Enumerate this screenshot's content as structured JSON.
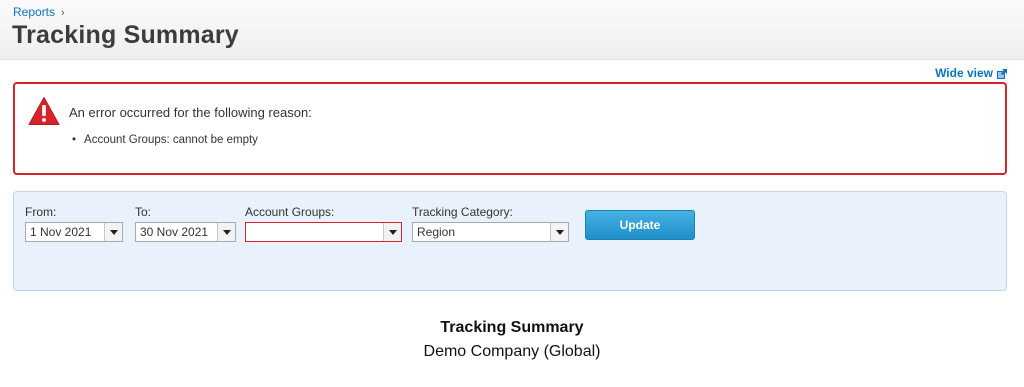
{
  "header": {
    "breadcrumb": {
      "link": "Reports",
      "separator": "›"
    },
    "title": "Tracking Summary"
  },
  "wide_view": {
    "label": "Wide view",
    "icon": "expand-icon"
  },
  "error": {
    "icon": "warning-icon",
    "title": "An error occurred for the following reason:",
    "items": [
      "Account Groups: cannot be empty"
    ],
    "border_color": "#d9232a"
  },
  "filters": {
    "from": {
      "label": "From:",
      "value": "1 Nov 2021"
    },
    "to": {
      "label": "To:",
      "value": "30 Nov 2021"
    },
    "account_groups": {
      "label": "Account Groups:",
      "value": ""
    },
    "tracking_category": {
      "label": "Tracking Category:",
      "value": "Region"
    },
    "update_label": "Update"
  },
  "report": {
    "title": "Tracking Summary",
    "subtitle": "Demo Company (Global)"
  },
  "colors": {
    "link": "#0b74c4",
    "accent_button": "#2a9fd6",
    "panel_bg": "#e9f1fc",
    "error": "#d9232a"
  }
}
